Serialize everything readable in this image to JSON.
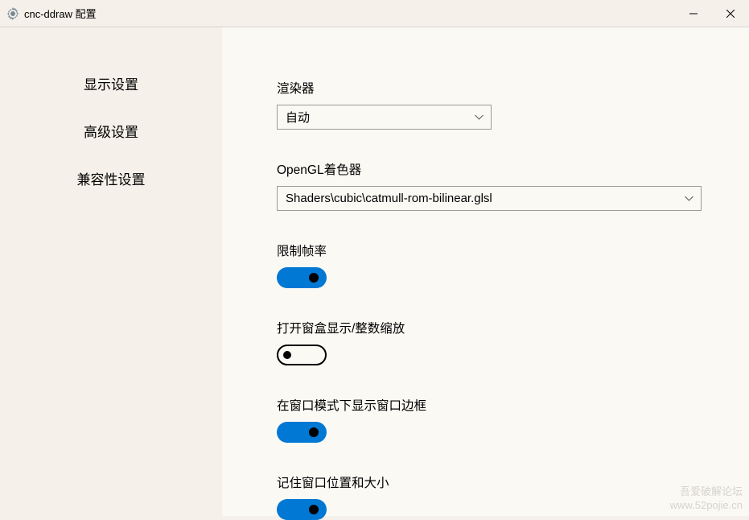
{
  "titlebar": {
    "title": "cnc-ddraw 配置"
  },
  "sidebar": {
    "items": [
      {
        "label": "显示设置"
      },
      {
        "label": "高级设置"
      },
      {
        "label": "兼容性设置"
      }
    ]
  },
  "settings": {
    "renderer": {
      "label": "渲染器",
      "value": "自动"
    },
    "shader": {
      "label": "OpenGL着色器",
      "value": "Shaders\\cubic\\catmull-rom-bilinear.glsl"
    },
    "fpslimit": {
      "label": "限制帧率",
      "value": true
    },
    "boxscaling": {
      "label": "打开窗盒显示/整数缩放",
      "value": false
    },
    "windowborder": {
      "label": "在窗口模式下显示窗口边框",
      "value": true
    },
    "remembersize": {
      "label": "记住窗口位置和大小",
      "value": true
    }
  },
  "watermark": {
    "line1": "吾爱破解论坛",
    "line2": "www.52pojie.cn"
  }
}
